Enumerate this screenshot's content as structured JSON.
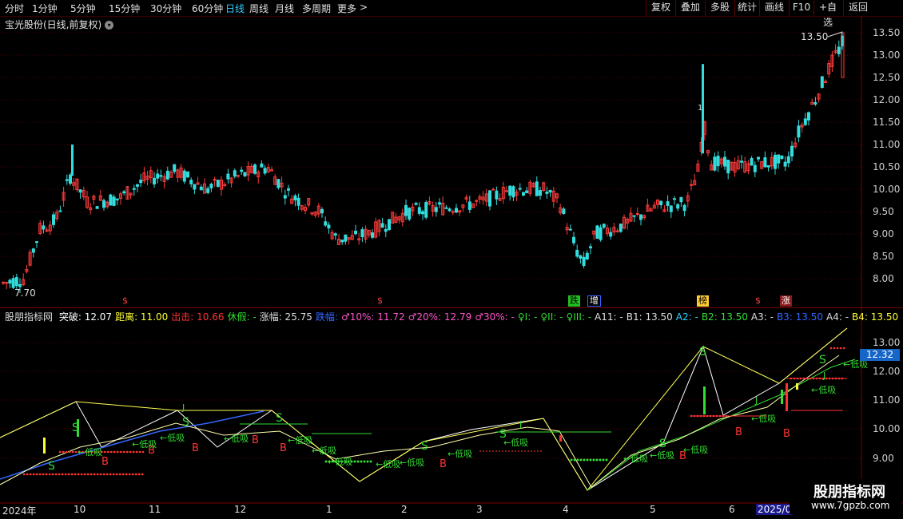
{
  "toolbar": {
    "periods": [
      "分时",
      "1分钟",
      "5分钟",
      "15分钟",
      "30分钟",
      "60分钟",
      "日线",
      "周线",
      "月线",
      "多周期",
      "更多"
    ],
    "active": "日线",
    "more_arrow": ">",
    "right_buttons": [
      "复权",
      "叠加",
      "多股",
      "统计",
      "画线",
      "F10",
      "+自选",
      "返回"
    ]
  },
  "chart_title": "宝光股份(日线,前复权)",
  "chart_title_icon": "chevron-down-icon",
  "price_axis": [
    "13.50",
    "13.00",
    "12.50",
    "12.00",
    "11.50",
    "11.00",
    "10.50",
    "10.00",
    "9.50",
    "9.00",
    "8.50",
    "8.00"
  ],
  "annotations": {
    "high": "13.50",
    "low": "7.70",
    "spike_label": "1"
  },
  "event_badges": [
    {
      "text": "$",
      "color": "#ff3b3b"
    },
    {
      "text": "$",
      "color": "#ff3b3b"
    },
    {
      "text": "跌",
      "color": "#22c122"
    },
    {
      "text": "增",
      "color": "#ffffff"
    },
    {
      "text": "榜",
      "color": "#ffcc33"
    },
    {
      "text": "$",
      "color": "#ff3b3b"
    },
    {
      "text": "涨",
      "color": "#ff3b3b"
    }
  ],
  "indicator": {
    "name": "股朋指标网",
    "fields": [
      {
        "text": "突破: 12.07",
        "color": "#ffffff"
      },
      {
        "text": "距离: 11.00",
        "color": "#ffff33"
      },
      {
        "text": "出击: 10.66",
        "color": "#ff3333"
      },
      {
        "text": "休假: -",
        "color": "#33dd33"
      },
      {
        "text": "涨幅: 25.75",
        "color": "#dddddd"
      },
      {
        "text": "跌幅:",
        "color": "#3366ff"
      },
      {
        "text": "♂10%: 11.72",
        "color": "#ff55cc"
      },
      {
        "text": "♂20%: 12.79",
        "color": "#ff55cc"
      },
      {
        "text": "♂30%: -",
        "color": "#ff55cc"
      },
      {
        "text": "♀I: -",
        "color": "#33dd33"
      },
      {
        "text": "♀II: -",
        "color": "#33dd33"
      },
      {
        "text": "♀III: -",
        "color": "#33dd33"
      },
      {
        "text": "A11: -",
        "color": "#dddddd"
      },
      {
        "text": "B1: 13.50",
        "color": "#dddddd"
      },
      {
        "text": "A2: -",
        "color": "#33ccff"
      },
      {
        "text": "B2: 13.50",
        "color": "#33dd33"
      },
      {
        "text": "A3: -",
        "color": "#dddddd"
      },
      {
        "text": "B3: 13.50",
        "color": "#3366ff"
      },
      {
        "text": "A4: -",
        "color": "#dddddd"
      },
      {
        "text": "B4: 13.50",
        "color": "#ffff33"
      }
    ]
  },
  "indicator_axis": [
    "13.00",
    "12.00",
    "11.00",
    "10.00",
    "9.00"
  ],
  "current_value": "12.32",
  "indicator_labels": {
    "buy": "B",
    "low": "←低吸",
    "sell": "S",
    "top": "J"
  },
  "time_axis": [
    "2024年",
    "10",
    "11",
    "12",
    "1",
    "2",
    "3",
    "4",
    "5",
    "6",
    "2025/0"
  ],
  "watermark": {
    "title": "股朋指标网",
    "url": "www.7gpzb.com"
  },
  "colors": {
    "up": "#ff3b3b",
    "down": "#33dddd",
    "bg": "#000000",
    "grid": "#7a0000"
  }
}
